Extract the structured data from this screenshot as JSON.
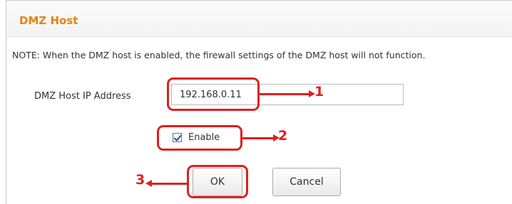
{
  "section": {
    "title": "DMZ Host"
  },
  "note": "NOTE: When the DMZ host is enabled, the firewall settings of the DMZ host will not function.",
  "dmz_ip": {
    "label": "DMZ Host IP Address",
    "value": "192.168.0.11"
  },
  "enable": {
    "label": "Enable",
    "checked": true
  },
  "buttons": {
    "ok": "OK",
    "cancel": "Cancel"
  },
  "callouts": [
    "1",
    "2",
    "3"
  ],
  "colors": {
    "title_orange": "#e8820c",
    "callout_red": "#e01f1f"
  }
}
